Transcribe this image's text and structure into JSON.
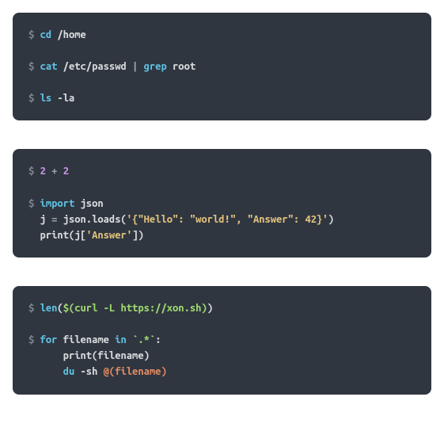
{
  "blocks": [
    {
      "groups": [
        {
          "lines": [
            [
              {
                "c": "tok-prompt",
                "t": "$ "
              },
              {
                "c": "tok-k",
                "t": "cd"
              },
              {
                "c": "tok-id",
                "t": " /home"
              }
            ]
          ]
        },
        {
          "lines": [
            [
              {
                "c": "tok-prompt",
                "t": "$ "
              },
              {
                "c": "tok-k",
                "t": "cat"
              },
              {
                "c": "tok-id",
                "t": " /etc/passwd "
              },
              {
                "c": "tok-pipe",
                "t": "|"
              },
              {
                "c": "tok-id",
                "t": " "
              },
              {
                "c": "tok-k",
                "t": "grep"
              },
              {
                "c": "tok-id",
                "t": " root"
              }
            ]
          ]
        },
        {
          "lines": [
            [
              {
                "c": "tok-prompt",
                "t": "$ "
              },
              {
                "c": "tok-k",
                "t": "ls"
              },
              {
                "c": "tok-id",
                "t": " -la"
              }
            ]
          ]
        }
      ]
    },
    {
      "groups": [
        {
          "lines": [
            [
              {
                "c": "tok-prompt",
                "t": "$ "
              },
              {
                "c": "tok-num",
                "t": "2"
              },
              {
                "c": "tok-op",
                "t": " + "
              },
              {
                "c": "tok-num",
                "t": "2"
              }
            ]
          ]
        },
        {
          "lines": [
            [
              {
                "c": "tok-prompt",
                "t": "$ "
              },
              {
                "c": "tok-k",
                "t": "import"
              },
              {
                "c": "tok-id",
                "t": " json"
              }
            ],
            [
              {
                "c": "tok-id",
                "t": "  j "
              },
              {
                "c": "tok-op",
                "t": "="
              },
              {
                "c": "tok-id",
                "t": " json.loads("
              },
              {
                "c": "tok-str-yellow",
                "t": "'{\"Hello\": \"world!\", \"Answer\": 42}'"
              },
              {
                "c": "tok-id",
                "t": ")"
              }
            ],
            [
              {
                "c": "tok-id",
                "t": "  print(j["
              },
              {
                "c": "tok-str-yellow",
                "t": "'Answer'"
              },
              {
                "c": "tok-id",
                "t": "])"
              }
            ]
          ]
        }
      ]
    },
    {
      "groups": [
        {
          "lines": [
            [
              {
                "c": "tok-prompt",
                "t": "$ "
              },
              {
                "c": "tok-k",
                "t": "len"
              },
              {
                "c": "tok-id",
                "t": "("
              },
              {
                "c": "tok-subproc",
                "t": "$("
              },
              {
                "c": "tok-subproc",
                "t": "curl -L https://xon.sh"
              },
              {
                "c": "tok-subproc",
                "t": ")"
              },
              {
                "c": "tok-id",
                "t": ")"
              }
            ]
          ]
        },
        {
          "lines": [
            [
              {
                "c": "tok-prompt",
                "t": "$ "
              },
              {
                "c": "tok-k",
                "t": "for"
              },
              {
                "c": "tok-id",
                "t": " filename "
              },
              {
                "c": "tok-k",
                "t": "in"
              },
              {
                "c": "tok-id",
                "t": " "
              },
              {
                "c": "tok-str-green",
                "t": "`.*`"
              },
              {
                "c": "tok-id",
                "t": ":"
              }
            ],
            [
              {
                "c": "tok-id",
                "t": "      print(filename)"
              }
            ],
            [
              {
                "c": "tok-id",
                "t": "      "
              },
              {
                "c": "tok-k",
                "t": "du"
              },
              {
                "c": "tok-id",
                "t": " -sh "
              },
              {
                "c": "tok-at",
                "t": "@("
              },
              {
                "c": "tok-at",
                "t": "filename"
              },
              {
                "c": "tok-at",
                "t": ")"
              }
            ]
          ]
        }
      ]
    }
  ]
}
